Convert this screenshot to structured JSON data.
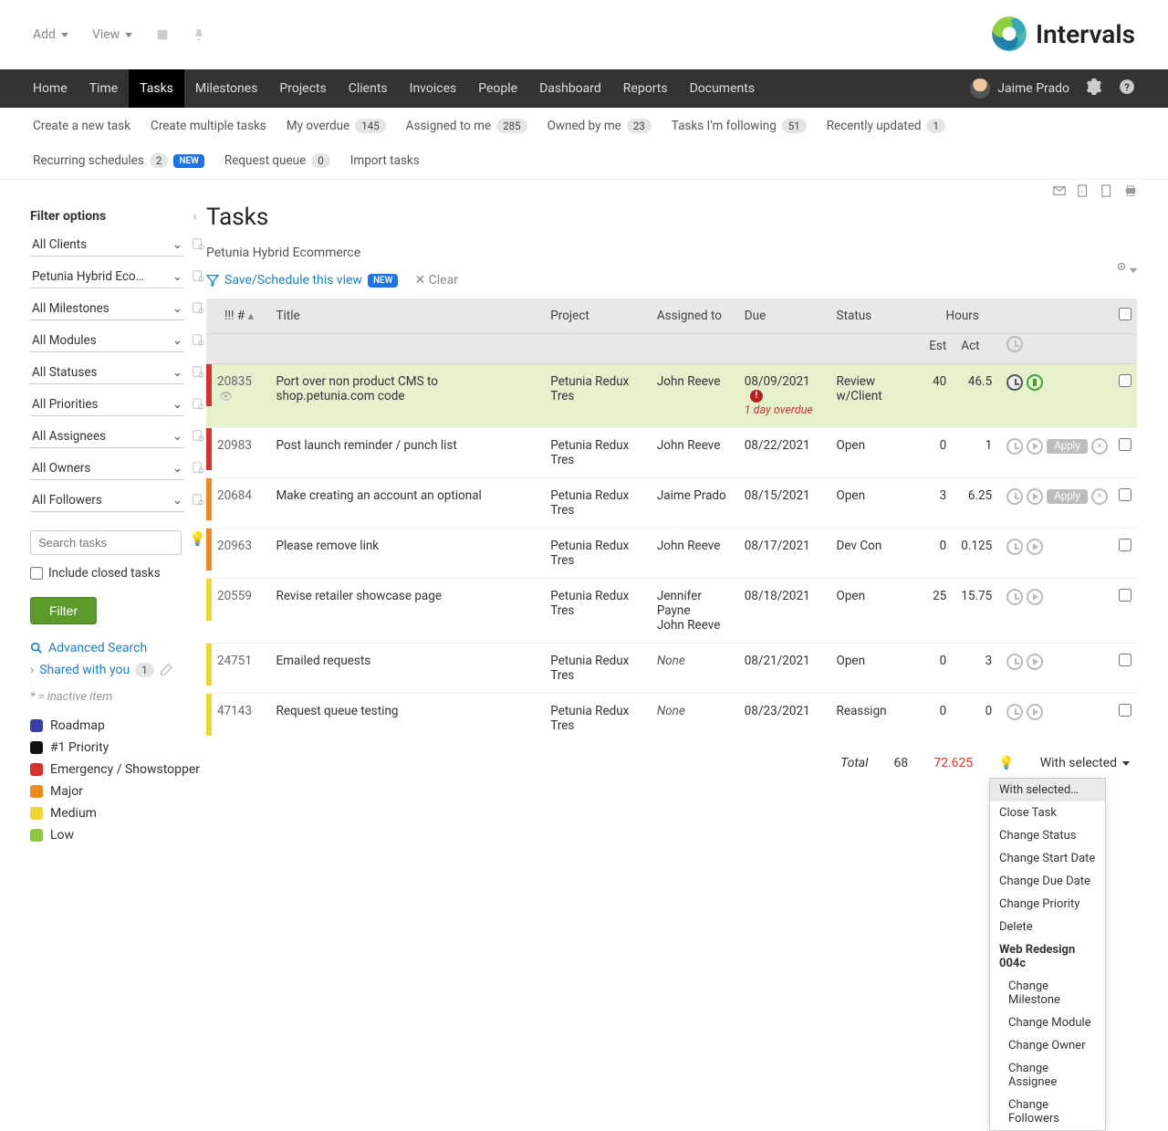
{
  "top_toolbar": {
    "add": "Add",
    "view": "View"
  },
  "brand": "Intervals",
  "user_name": "Jaime Prado",
  "main_nav": [
    "Home",
    "Time",
    "Tasks",
    "Milestones",
    "Projects",
    "Clients",
    "Invoices",
    "People",
    "Dashboard",
    "Reports",
    "Documents"
  ],
  "sub_nav": [
    {
      "label": "Create a new task"
    },
    {
      "label": "Create multiple tasks"
    },
    {
      "label": "My overdue",
      "badge": "145"
    },
    {
      "label": "Assigned to me",
      "badge": "285"
    },
    {
      "label": "Owned by me",
      "badge": "23"
    },
    {
      "label": "Tasks I'm following",
      "badge": "51"
    },
    {
      "label": "Recently updated",
      "badge": "1"
    },
    {
      "label": "Recurring schedules",
      "badge": "2",
      "new": "NEW"
    },
    {
      "label": "Request queue",
      "badge": "0"
    },
    {
      "label": "Import tasks"
    }
  ],
  "sidebar": {
    "heading": "Filter options",
    "filters": [
      "All Clients",
      "Petunia Hybrid Ecommerce",
      "All Milestones",
      "All Modules",
      "All Statuses",
      "All Priorities",
      "All Assignees",
      "All Owners",
      "All Followers"
    ],
    "search_placeholder": "Search tasks",
    "include_closed": "Include closed tasks",
    "filter_btn": "Filter",
    "advanced": "Advanced Search",
    "shared": "Shared with you",
    "shared_count": "1",
    "inactive_note": "* = inactive item",
    "legend": [
      {
        "label": "Roadmap",
        "color": "#3b3ea8"
      },
      {
        "label": "#1 Priority",
        "color": "#111"
      },
      {
        "label": "Emergency / Showstopper",
        "color": "#d7322e"
      },
      {
        "label": "Major",
        "color": "#ef8b1e"
      },
      {
        "label": "Medium",
        "color": "#f3d531"
      },
      {
        "label": "Low",
        "color": "#8dc63f"
      }
    ]
  },
  "page": {
    "title": "Tasks",
    "subtitle": "Petunia Hybrid Ecommerce",
    "save_view": "Save/Schedule this view",
    "save_view_badge": "NEW",
    "clear": "Clear"
  },
  "columns": {
    "num": "#",
    "title": "Title",
    "project": "Project",
    "assigned": "Assigned to",
    "due": "Due",
    "status": "Status",
    "hours": "Hours",
    "est": "Est",
    "act": "Act"
  },
  "rows": [
    {
      "prio": "#d7322e",
      "id": "20835",
      "eye": true,
      "title": "Port over non product CMS to shop.petunia.com code",
      "project": "Petunia Redux Tres",
      "assigned": "John Reeve",
      "due": "08/09/2021",
      "overdue": "1 day overdue",
      "alert": true,
      "status": "Review w/Client",
      "est": "40",
      "act": "46.5",
      "act_red": true,
      "timers": "running",
      "hl": true
    },
    {
      "prio": "#d7322e",
      "id": "20983",
      "title": "Post launch reminder / punch list",
      "project": "Petunia Redux Tres",
      "assigned": "John Reeve",
      "due": "08/22/2021",
      "status": "Open",
      "est": "0",
      "act": "1",
      "timers": "apply"
    },
    {
      "prio": "#ef8b1e",
      "id": "20684",
      "title": "Make creating an account an optional",
      "project": "Petunia Redux Tres",
      "assigned": "Jaime Prado",
      "due": "08/15/2021",
      "status": "Open",
      "est": "3",
      "act": "6.25",
      "act_red": true,
      "timers": "apply"
    },
    {
      "prio": "#ef8b1e",
      "id": "20963",
      "title": "Please remove link",
      "project": "Petunia Redux Tres",
      "assigned": "John Reeve",
      "due": "08/17/2021",
      "status": "Dev Con",
      "est": "0",
      "act": "0.125",
      "timers": "idle"
    },
    {
      "prio": "#f3d531",
      "id": "20559",
      "title": "Revise retailer showcase page",
      "project": "Petunia Redux Tres",
      "assigned": "Jennifer Payne\nJohn Reeve",
      "due": "08/18/2021",
      "status": "Open",
      "est": "25",
      "act": "15.75",
      "timers": "idle"
    },
    {
      "prio": "#f3d531",
      "id": "24751",
      "title": "Emailed requests",
      "project": "Petunia Redux Tres",
      "assigned": "None",
      "assigned_none": true,
      "due": "08/21/2021",
      "status": "Open",
      "est": "0",
      "act": "3",
      "timers": "idle"
    },
    {
      "prio": "#f3d531",
      "id": "47143",
      "title": "Request queue testing",
      "project": "Petunia Redux Tres",
      "assigned": "None",
      "assigned_none": true,
      "due": "08/23/2021",
      "status": "Reassign",
      "est": "0",
      "act": "0",
      "timers": "idle"
    }
  ],
  "totals": {
    "label": "Total",
    "est": "68",
    "act": "72.625",
    "with_selected": "With selected"
  },
  "apply_label": "Apply",
  "dropdown": {
    "header": "With selected…",
    "group1": [
      "Close Task",
      "Change Status",
      "Change Start Date",
      "Change Due Date",
      "Change Priority",
      "Delete"
    ],
    "project_hdr": "Web Redesign 004c",
    "group2": [
      "Change Milestone",
      "Change Module",
      "Change Owner",
      "Change Assignee",
      "Change Followers"
    ]
  }
}
